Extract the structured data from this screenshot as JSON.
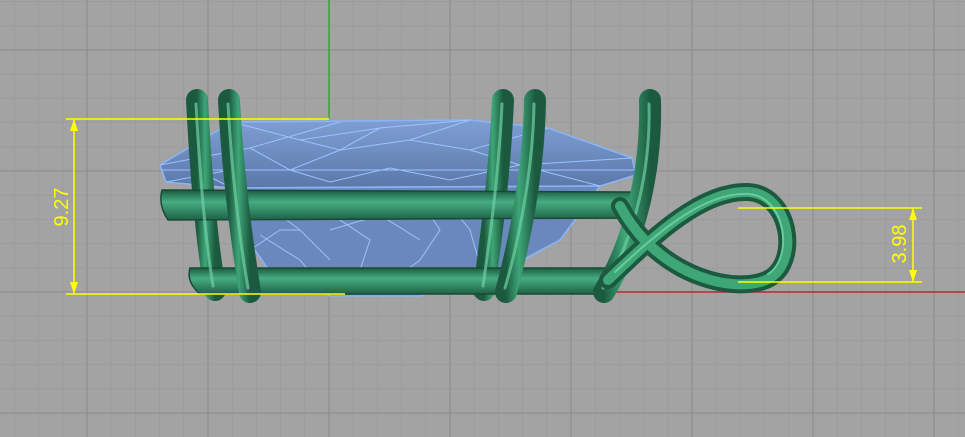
{
  "viewport": {
    "background": "#a3a3a3",
    "grid_minor_color": "#9a9a9a",
    "grid_major_color": "#8e8e8e",
    "axis_x_color": "#b03030",
    "axis_y_color": "#3aa53a"
  },
  "model": {
    "metal_color": "#2d8a63",
    "metal_dark": "#1c5a40",
    "metal_light": "#52b48a",
    "gem_fill": "#6f8fc2",
    "gem_wire": "#8ab4f5"
  },
  "dimensions": [
    {
      "name": "total-height-dimension",
      "value": "9.27",
      "color": "#ffff00"
    },
    {
      "name": "bail-height-dimension",
      "value": "3.98",
      "color": "#ffff00"
    }
  ]
}
